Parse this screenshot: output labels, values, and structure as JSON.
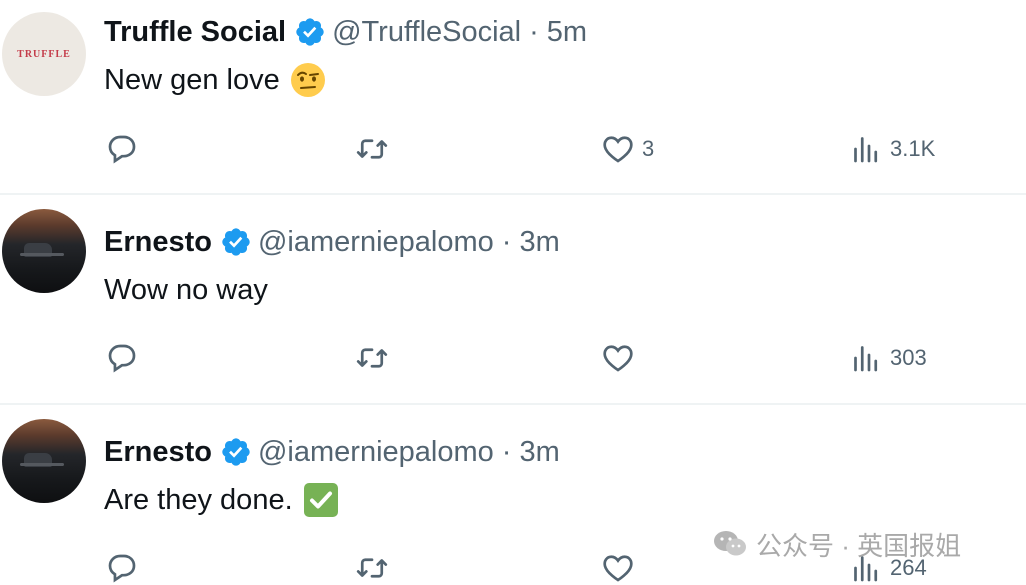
{
  "tweets": [
    {
      "name": "Truffle Social",
      "handle": "@TruffleSocial",
      "separator": "·",
      "time": "5m",
      "text": "New gen love",
      "emoji": "face-with-raised-eyebrow",
      "avatar_text": "TRUFFLE",
      "reply_count": "",
      "retweet_count": "",
      "like_count": "3",
      "view_count": "3.1K"
    },
    {
      "name": "Ernesto",
      "handle": "@iamerniepalomo",
      "separator": "·",
      "time": "3m",
      "text": "Wow no way",
      "reply_count": "",
      "retweet_count": "",
      "like_count": "",
      "view_count": "303"
    },
    {
      "name": "Ernesto",
      "handle": "@iamerniepalomo",
      "separator": "·",
      "time": "3m",
      "text": "Are they done.",
      "emoji": "check-mark-button",
      "reply_count": "",
      "retweet_count": "",
      "like_count": "",
      "view_count": "264"
    }
  ],
  "watermark": {
    "label": "公众号 · 英国报姐"
  },
  "colors": {
    "verified": "#1d9bf0",
    "muted": "#536471",
    "text": "#0f1419",
    "divider": "#eff3f4",
    "check_green": "#77b255",
    "emoji_yellow": "#ffcc4d"
  },
  "icons": {
    "reply": "reply-bubble-icon",
    "retweet": "retweet-arrows-icon",
    "like": "heart-icon",
    "views": "views-bars-icon",
    "verified": "verified-badge-icon"
  }
}
